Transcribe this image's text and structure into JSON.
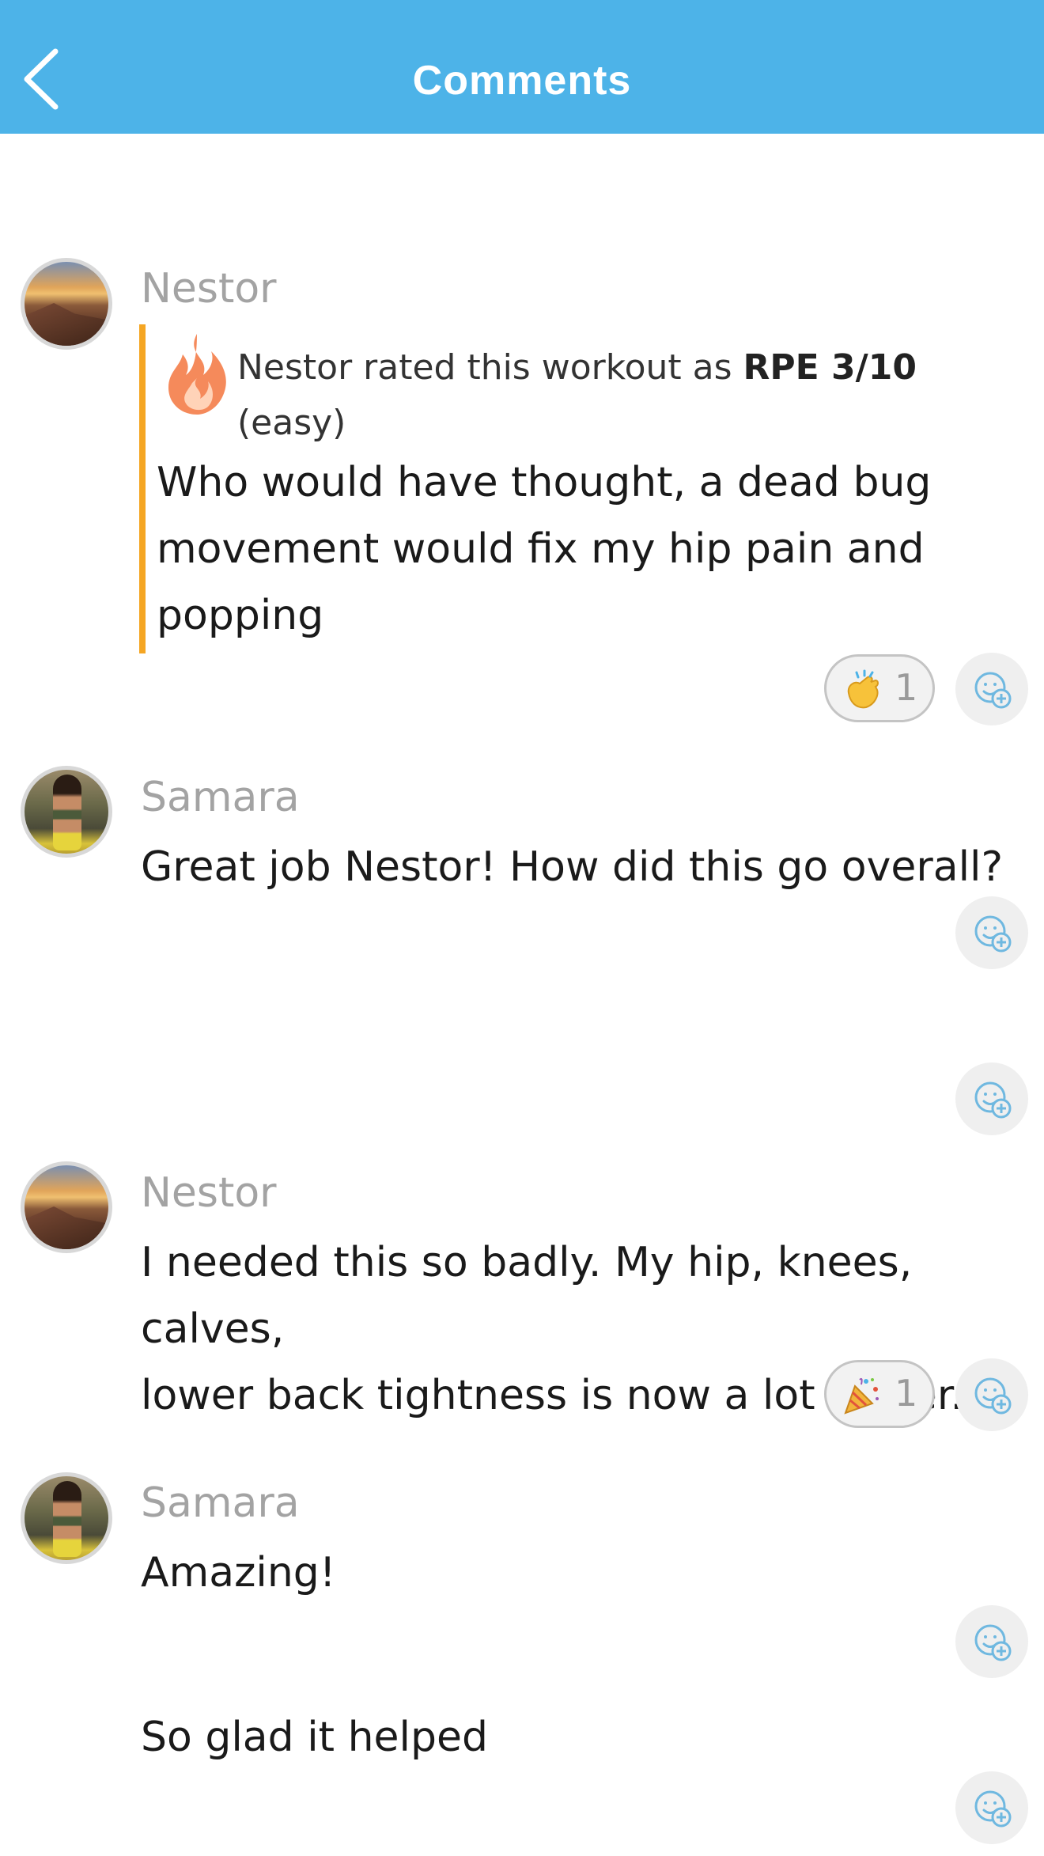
{
  "header": {
    "title": "Comments",
    "back_icon": "chevron-left-icon",
    "color": "#4db3e8"
  },
  "comments": [
    {
      "author": "Nestor",
      "rating": {
        "prefix": "Nestor rated this workout as ",
        "value": "RPE 3/10",
        "note": "(easy)",
        "icon": "flame-icon"
      },
      "lines": [
        "Who would have thought, a dead bug",
        "movement would fix my hip pain and",
        "popping"
      ],
      "reaction": {
        "emoji": "clapping-hands-icon",
        "count": "1"
      }
    },
    {
      "author": "Samara",
      "lines": [
        "Great job Nestor! How did this go overall?"
      ]
    },
    {
      "author": "Nestor",
      "lines": [
        "I needed this so badly. My hip, knees, calves,",
        "lower back tightness is now a lot better."
      ],
      "reaction": {
        "emoji": "party-popper-icon",
        "count": "1"
      }
    },
    {
      "author": "Samara",
      "lines": [
        "Amazing!",
        "So glad it helped"
      ]
    }
  ],
  "colors": {
    "accent_bar": "#f5a623",
    "name_gray": "#a3a3a3"
  }
}
